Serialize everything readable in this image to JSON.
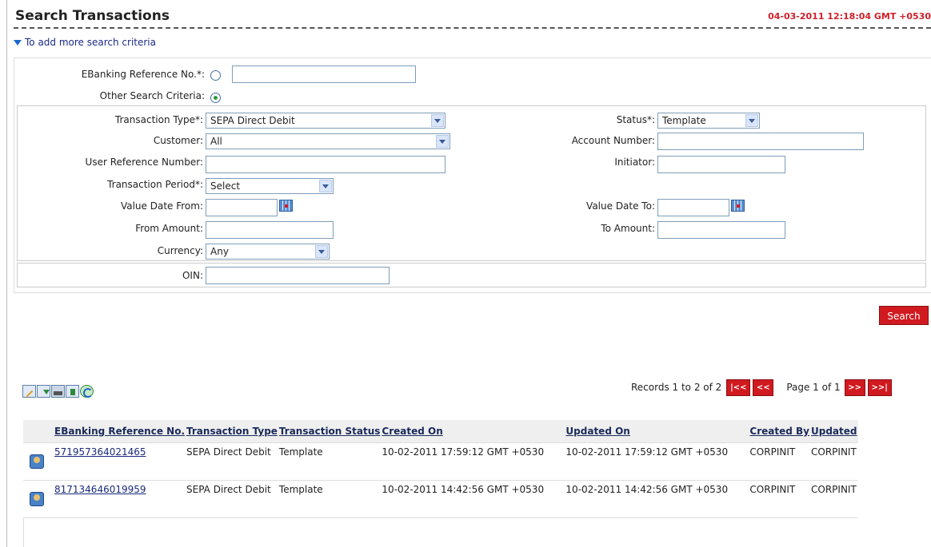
{
  "header": {
    "title": "Search Transactions",
    "timestamp": "04-03-2011 12:18:04 GMT +0530",
    "more_criteria": "To add more search criteria"
  },
  "criteria": {
    "ebanking_ref_label": "EBanking Reference No.*:",
    "ebanking_ref_value": "",
    "other_criteria_label": "Other Search Criteria:",
    "selected_mode": "other"
  },
  "form": {
    "transaction_type_label": "Transaction Type*:",
    "transaction_type_value": "SEPA Direct Debit",
    "status_label": "Status*:",
    "status_value": "Template",
    "customer_label": "Customer:",
    "customer_value": "All",
    "account_number_label": "Account Number:",
    "user_ref_label": "User Reference Number:",
    "initiator_label": "Initiator:",
    "transaction_period_label": "Transaction Period*:",
    "transaction_period_value": "Select",
    "value_date_from_label": "Value Date From:",
    "value_date_to_label": "Value Date To:",
    "from_amount_label": "From Amount:",
    "to_amount_label": "To Amount:",
    "currency_label": "Currency:",
    "currency_value": "Any",
    "oin_label": "OIN:"
  },
  "actions": {
    "search_label": "Search"
  },
  "pager": {
    "records_text": "Records 1 to 2 of 2",
    "first": "|<<",
    "prev": "<<",
    "page_text": "Page 1 of 1",
    "next": ">>",
    "last": ">>|"
  },
  "table": {
    "columns": [
      "EBanking Reference No.",
      "Transaction Type",
      "Transaction Status",
      "Created On",
      "Updated On",
      "Created By",
      "Updated"
    ],
    "rows": [
      {
        "ref": "571957364021465",
        "type": "SEPA Direct Debit",
        "status": "Template",
        "created_on": "10-02-2011 17:59:12 GMT +0530",
        "updated_on": "10-02-2011 17:59:12 GMT +0530",
        "created_by": "CORPINIT",
        "updated_by": "CORPINIT"
      },
      {
        "ref": "817134646019959",
        "type": "SEPA Direct Debit",
        "status": "Template",
        "created_on": "10-02-2011 14:42:56 GMT +0530",
        "updated_on": "10-02-2011 14:42:56 GMT +0530",
        "created_by": "CORPINIT",
        "updated_by": "CORPINIT"
      }
    ]
  },
  "icons": [
    "edit-icon",
    "download-icon",
    "print-icon",
    "export-icon",
    "refresh-icon",
    "transaction-detail-icon"
  ]
}
